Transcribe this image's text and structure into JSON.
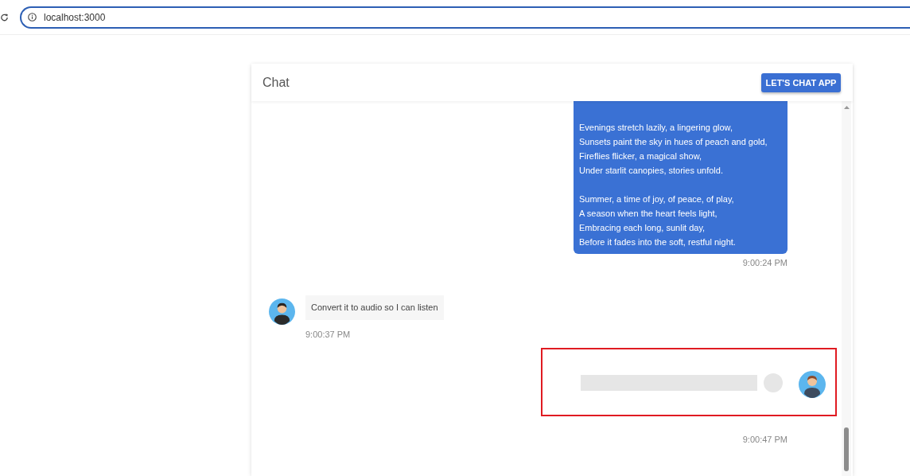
{
  "browser": {
    "address": "localhost:3000"
  },
  "chat": {
    "title": "Chat",
    "header_button": "LET'S CHAT APP"
  },
  "messages": [
    {
      "kind": "poem",
      "stanzas": [
        [
          "Evenings stretch lazily, a lingering glow,",
          "Sunsets paint the sky in hues of peach and gold,",
          "Fireflies flicker, a magical show,",
          "Under starlit canopies, stories unfold."
        ],
        [
          "Summer, a time of joy, of peace, of play,",
          "A season when the heart feels light,",
          "Embracing each long, sunlit day,",
          "Before it fades into the soft, restful night."
        ]
      ],
      "time": "9:00:24 PM"
    },
    {
      "kind": "text",
      "text": "Convert it to audio so I can listen",
      "time": "9:00:37 PM"
    },
    {
      "kind": "loading",
      "highlighted": true,
      "time": "9:00:47 PM"
    }
  ]
}
